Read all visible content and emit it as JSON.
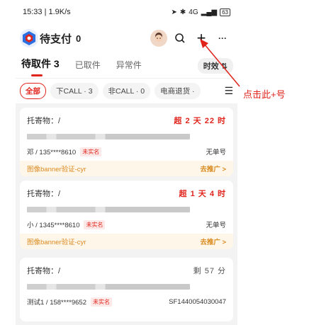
{
  "status_bar": {
    "time_speed": "15:33 | 1.9K/s",
    "network": "4G",
    "battery": "63"
  },
  "header": {
    "title": "待支付",
    "count": "0",
    "add_symbol": "+",
    "more_symbol": "···"
  },
  "tabs": [
    {
      "label": "待取件 3",
      "active": true
    },
    {
      "label": "已取件",
      "active": false
    },
    {
      "label": "异常件",
      "active": false
    }
  ],
  "tab_effect": "时效",
  "filters": [
    {
      "label": "全部",
      "active": true
    },
    {
      "label": "下CALL · 3",
      "active": false
    },
    {
      "label": "非CALL · 0",
      "active": false
    },
    {
      "label": "电商退货 ·",
      "active": false
    }
  ],
  "cards": [
    {
      "sender": "托寄物：/",
      "time_left": "超 2 天 22 时",
      "overdue": true,
      "contact": "邓 / 135****8610",
      "tag": "未实名",
      "order_no": "无单号",
      "banner": "图像banner验证-cyr",
      "promote": "去推广 >"
    },
    {
      "sender": "托寄物：/",
      "time_left": "超 1 天 4 时",
      "overdue": true,
      "contact": "小 / 1345****8610",
      "tag": "未实名",
      "order_no": "无单号",
      "banner": "图像banner验证-cyr",
      "promote": "去推广 >"
    },
    {
      "sender": "托寄物：/",
      "time_left": "剩 57 分",
      "overdue": false,
      "contact": "测试1 / 158****9652",
      "tag": "未实名",
      "order_no": "SF1440054030047"
    }
  ],
  "annotation": {
    "text": "点击此+号",
    "color": "#e0241c"
  },
  "colors": {
    "accent": "#e0241c",
    "banner_text": "#d98a1e"
  }
}
